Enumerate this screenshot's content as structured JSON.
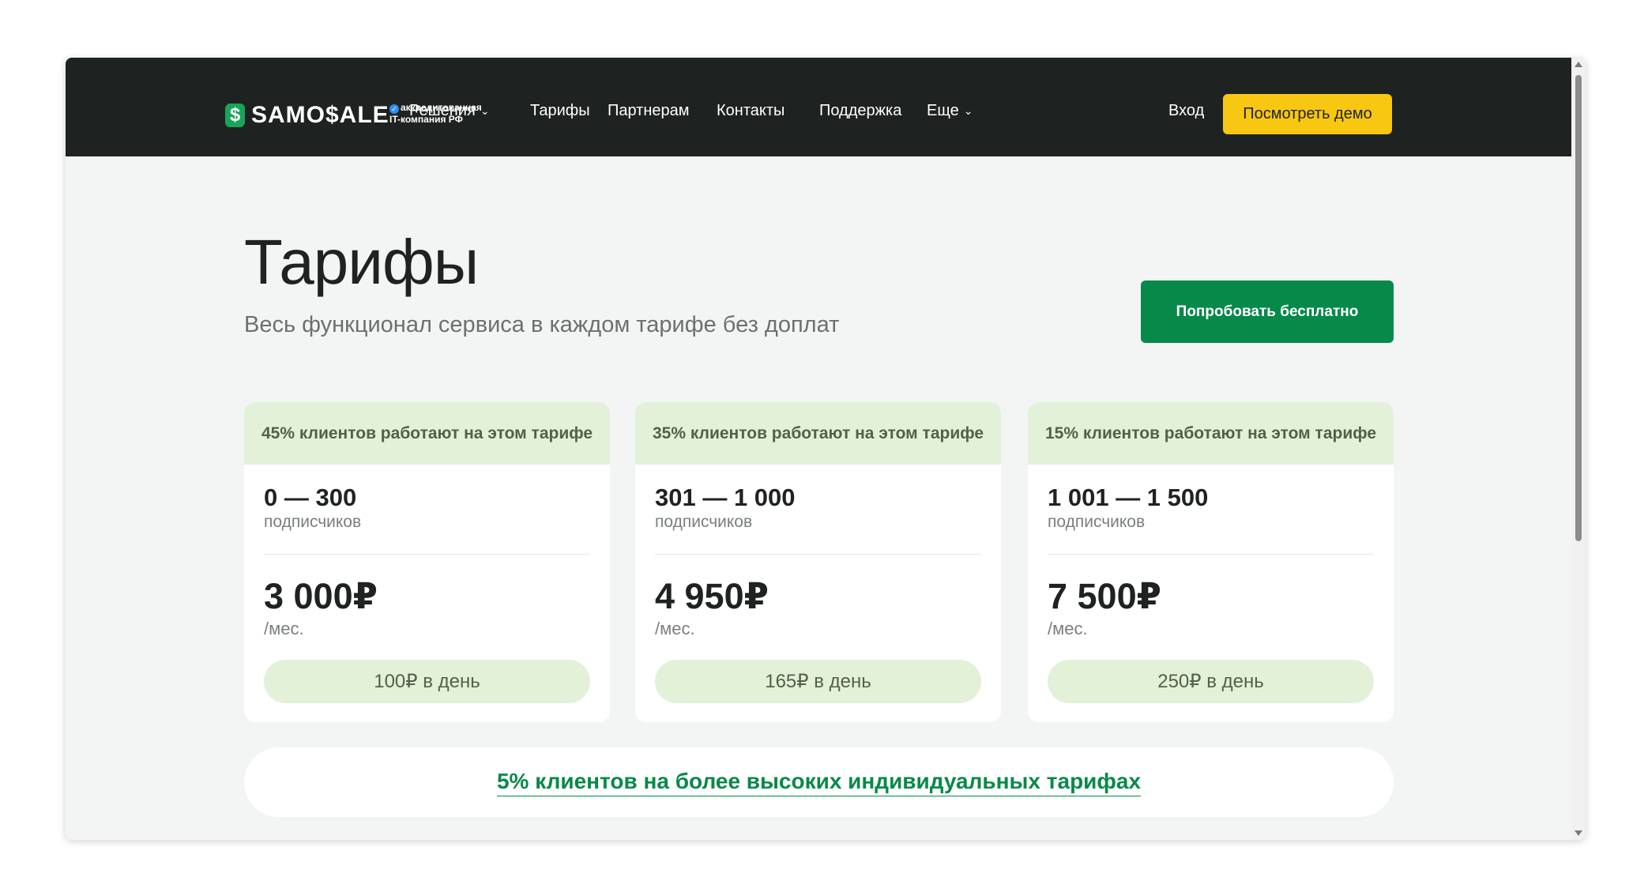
{
  "header": {
    "logo_mark": "$",
    "logo_text": "SAMO$ALE",
    "accreditation_line1": "аккредитованная",
    "accreditation_line2": "IT-компания РФ",
    "nav": [
      {
        "label": "Решения",
        "has_dropdown": true
      },
      {
        "label": "Тарифы",
        "has_dropdown": false
      },
      {
        "label": "Партнерам",
        "has_dropdown": false
      },
      {
        "label": "Контакты",
        "has_dropdown": false
      },
      {
        "label": "Поддержка",
        "has_dropdown": false
      },
      {
        "label": "Еще",
        "has_dropdown": true
      }
    ],
    "login_label": "Вход",
    "demo_button_label": "Посмотреть демо"
  },
  "main": {
    "title": "Тарифы",
    "subtitle": "Весь функционал сервиса в каждом тарифе без доплат",
    "try_button_label": "Попробовать бесплатно"
  },
  "plans": [
    {
      "share": "45% клиентов работают на этом тарифе",
      "range": "0 — 300",
      "unit": "подписчиков",
      "price": "3 000₽",
      "period": "/мес.",
      "per_day": "100₽ в день"
    },
    {
      "share": "35% клиентов работают на этом тарифе",
      "range": "301 — 1 000",
      "unit": "подписчиков",
      "price": "4 950₽",
      "period": "/мес.",
      "per_day": "165₽ в день"
    },
    {
      "share": "15% клиентов работают на этом тарифе",
      "range": "1 001 — 1 500",
      "unit": "подписчиков",
      "price": "7 500₽",
      "period": "/мес.",
      "per_day": "250₽ в день"
    }
  ],
  "banner": {
    "link_text": "5% клиентов на более высоких индивидуальных тарифах"
  },
  "icons": {
    "chevron": "chevron-down-icon",
    "verified": "verified-check-icon"
  },
  "colors": {
    "header_bg": "#1e2221",
    "accent_yellow": "#f8c711",
    "accent_green": "#07894a",
    "soft_green": "#e2f1d8"
  }
}
